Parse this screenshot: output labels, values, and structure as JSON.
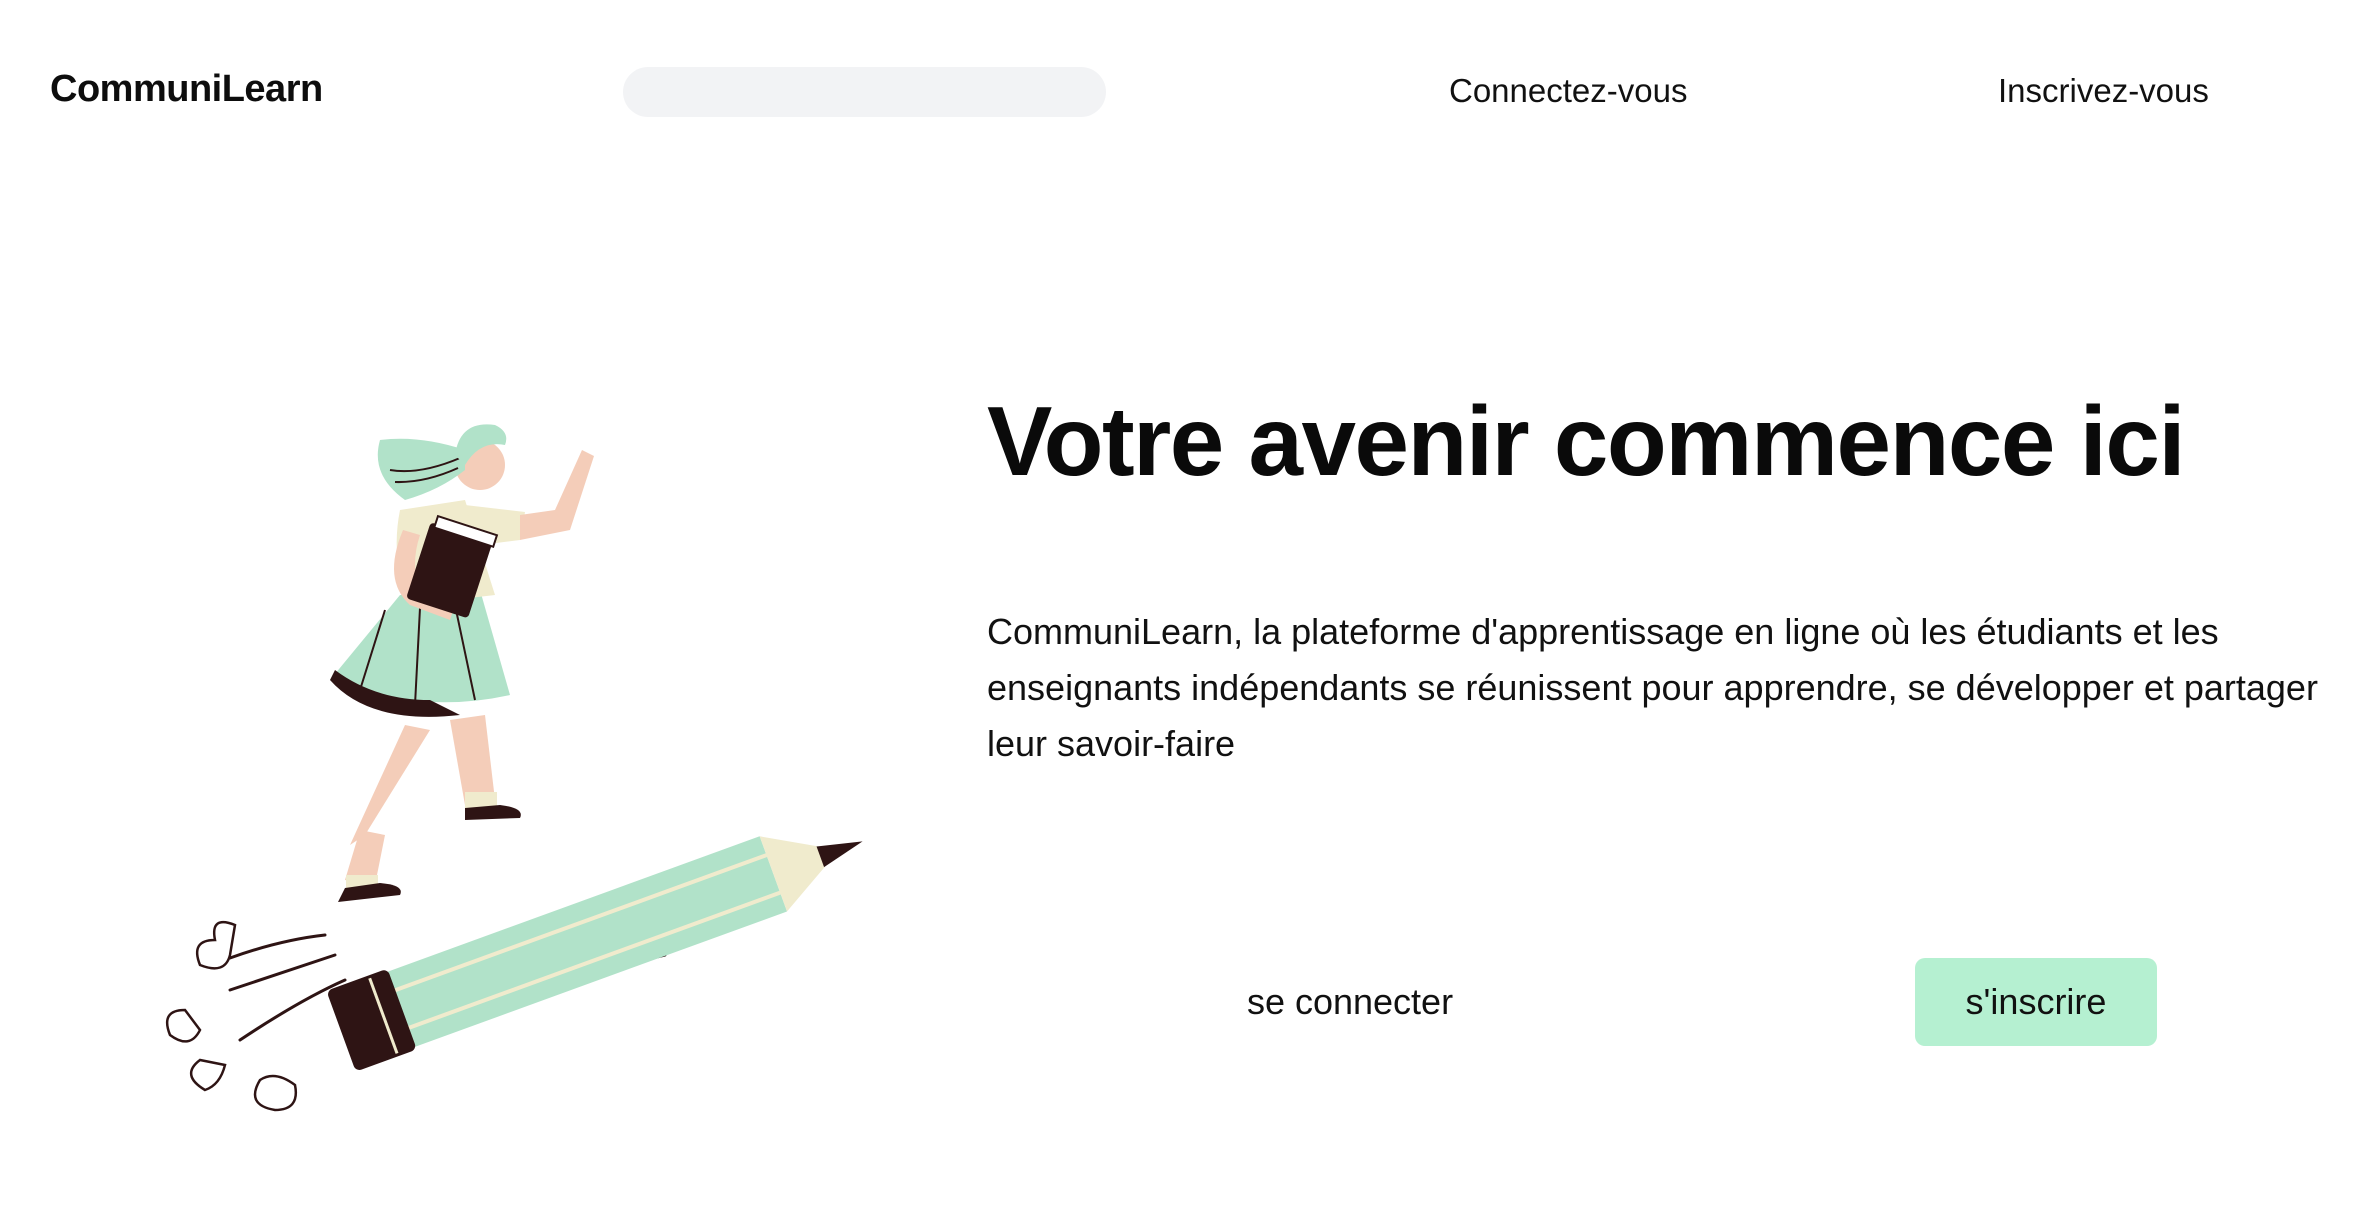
{
  "header": {
    "brand": "CommuniLearn",
    "search_placeholder": "",
    "login_link": "Connectez-vous",
    "signup_link": "Inscrivez-vous"
  },
  "hero": {
    "title": "Votre avenir commence ici",
    "description": "CommuniLearn, la plateforme d'apprentissage en ligne où les étudiants et les enseignants indépendants se réunissent pour apprendre, se développer et partager leur savoir-faire",
    "login_button": "se connecter",
    "signup_button": "s'inscrire"
  },
  "colors": {
    "accent": "#b5f0d1",
    "mint": "#b1e2c9",
    "cream": "#f0ebcd",
    "skin": "#f4cdb9",
    "dark": "#2e1414",
    "search_bg": "#f2f3f5"
  },
  "illustration": {
    "icon": "girl-riding-pencil-illustration"
  }
}
